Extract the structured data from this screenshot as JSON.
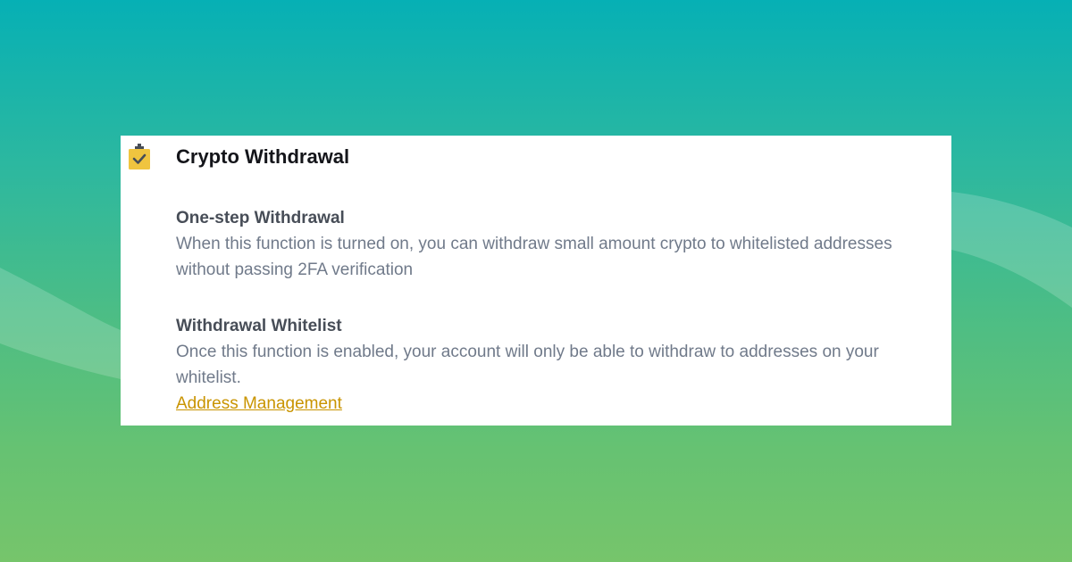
{
  "background": {
    "gradient_top": "#06b0b5",
    "gradient_bottom": "#76c56b"
  },
  "card": {
    "title": "Crypto Withdrawal",
    "icon": "clipboard-check-icon",
    "icon_color": "#f0c43f",
    "sections": [
      {
        "title": "One-step Withdrawal",
        "description": "When this function is turned on, you can withdraw small amount crypto to whitelisted addresses without passing 2FA verification"
      },
      {
        "title": "Withdrawal Whitelist",
        "description": "Once this function is enabled, your account will only be able to withdraw to addresses on your whitelist.",
        "link_label": "Address Management"
      }
    ]
  },
  "colors": {
    "title": "#14151a",
    "section_title": "#474d57",
    "description": "#707a8a",
    "link": "#c99400"
  }
}
